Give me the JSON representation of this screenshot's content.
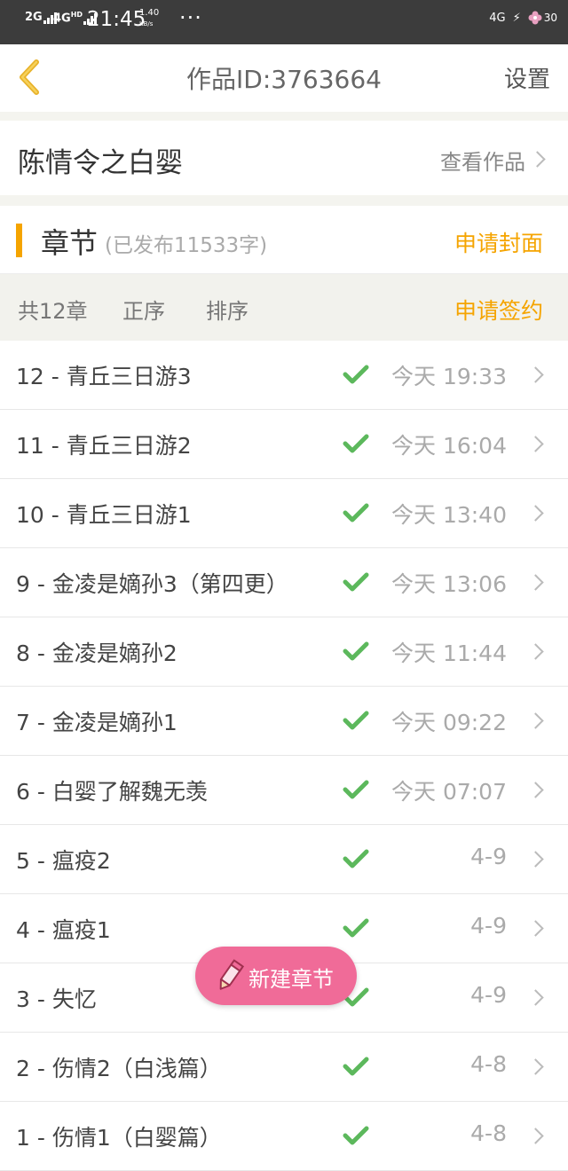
{
  "status_bar": {
    "signal1": "2G",
    "signal2": "4G",
    "signal2_sup": "HD",
    "time": "21:45",
    "speed_value": "1.40",
    "speed_unit": "KB/s",
    "more": "···",
    "network_right": "4G",
    "battery": "30"
  },
  "header": {
    "title": "作品ID:3763664",
    "settings_label": "设置"
  },
  "work": {
    "name": "陈情令之白婴",
    "view_label": "查看作品"
  },
  "chapters_section": {
    "label": "章节",
    "published": "(已发布11533字)",
    "cover_label": "申请封面",
    "total": "共12章",
    "order_label": "正序",
    "sort_label": "排序",
    "sign_label": "申请签约"
  },
  "chapters": [
    {
      "title": "12 - 青丘三日游3",
      "date": "今天 19:33",
      "published": true
    },
    {
      "title": "11 - 青丘三日游2",
      "date": "今天 16:04",
      "published": true
    },
    {
      "title": "10 - 青丘三日游1",
      "date": "今天 13:40",
      "published": true
    },
    {
      "title": "9 - 金凌是嫡孙3（第四更）",
      "date": "今天 13:06",
      "published": true
    },
    {
      "title": "8 - 金凌是嫡孙2",
      "date": "今天 11:44",
      "published": true
    },
    {
      "title": "7 - 金凌是嫡孙1",
      "date": "今天 09:22",
      "published": true
    },
    {
      "title": "6 - 白婴了解魏无羡",
      "date": "今天 07:07",
      "published": true
    },
    {
      "title": "5 - 瘟疫2",
      "date": "4-9",
      "published": true
    },
    {
      "title": "4 - 瘟疫1",
      "date": "4-9",
      "published": true
    },
    {
      "title": "3 - 失忆",
      "date": "4-9",
      "published": true
    },
    {
      "title": "2 - 伤情2（白浅篇）",
      "date": "4-8",
      "published": true
    },
    {
      "title": "1 - 伤情1（白婴篇）",
      "date": "4-8",
      "published": true
    }
  ],
  "fab": {
    "label": "新建章节"
  },
  "colors": {
    "accent": "#f5a400",
    "check": "#5cb85c",
    "fab": "#f06b98"
  }
}
